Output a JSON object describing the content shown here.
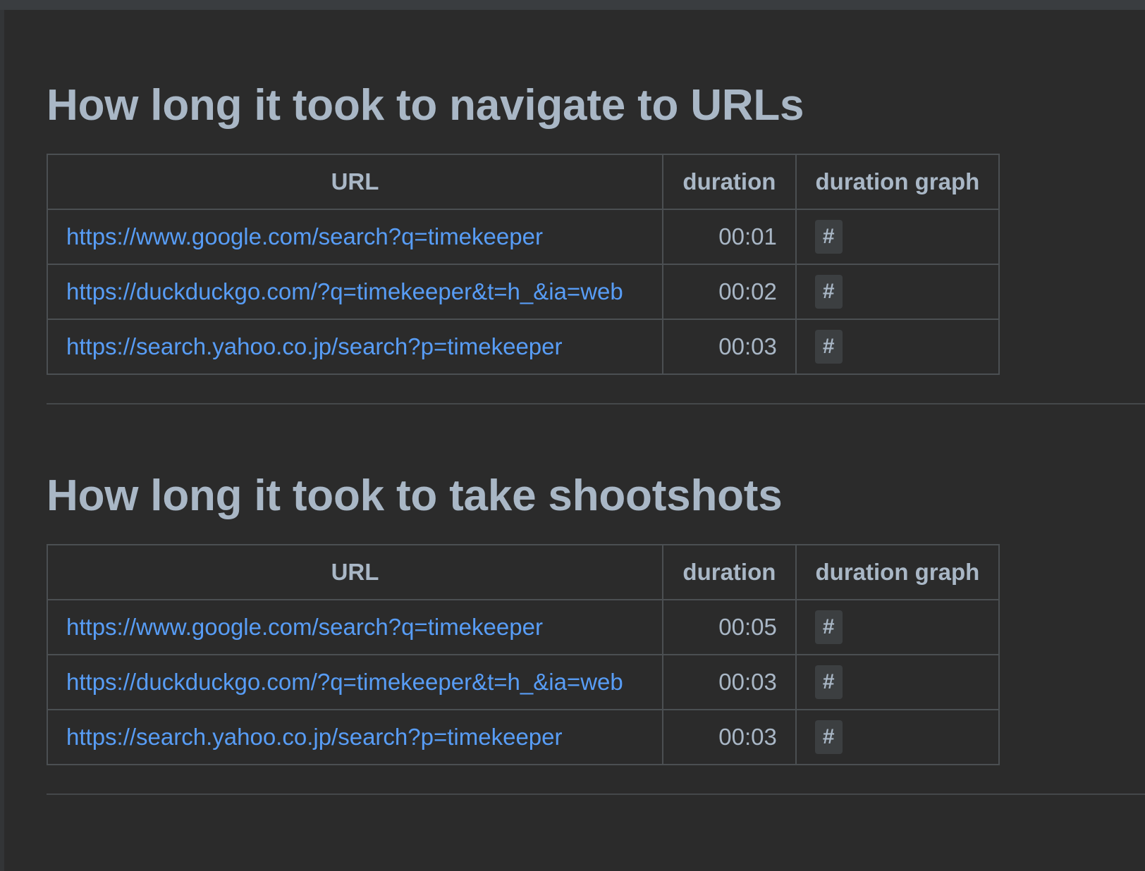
{
  "section_1": {
    "title": "How long it took to navigate to URLs",
    "headers": [
      "URL",
      "duration",
      "duration graph"
    ],
    "rows": [
      {
        "url": "https://www.google.com/search?q=timekeeper",
        "duration": "00:01",
        "graph": "#"
      },
      {
        "url": "https://duckduckgo.com/?q=timekeeper&t=h_&ia=web",
        "duration": "00:02",
        "graph": "#"
      },
      {
        "url": "https://search.yahoo.co.jp/search?p=timekeeper",
        "duration": "00:03",
        "graph": "#"
      }
    ]
  },
  "section_2": {
    "title": "How long it took to take shootshots",
    "headers": [
      "URL",
      "duration",
      "duration graph"
    ],
    "rows": [
      {
        "url": "https://www.google.com/search?q=timekeeper",
        "duration": "00:05",
        "graph": "#"
      },
      {
        "url": "https://duckduckgo.com/?q=timekeeper&t=h_&ia=web",
        "duration": "00:03",
        "graph": "#"
      },
      {
        "url": "https://search.yahoo.co.jp/search?p=timekeeper",
        "duration": "00:03",
        "graph": "#"
      }
    ]
  },
  "colors": {
    "background": "#2b2b2b",
    "text": "#a9b7c6",
    "link": "#589df6",
    "border": "#4b4f52",
    "bar_background": "#3c3f41"
  }
}
